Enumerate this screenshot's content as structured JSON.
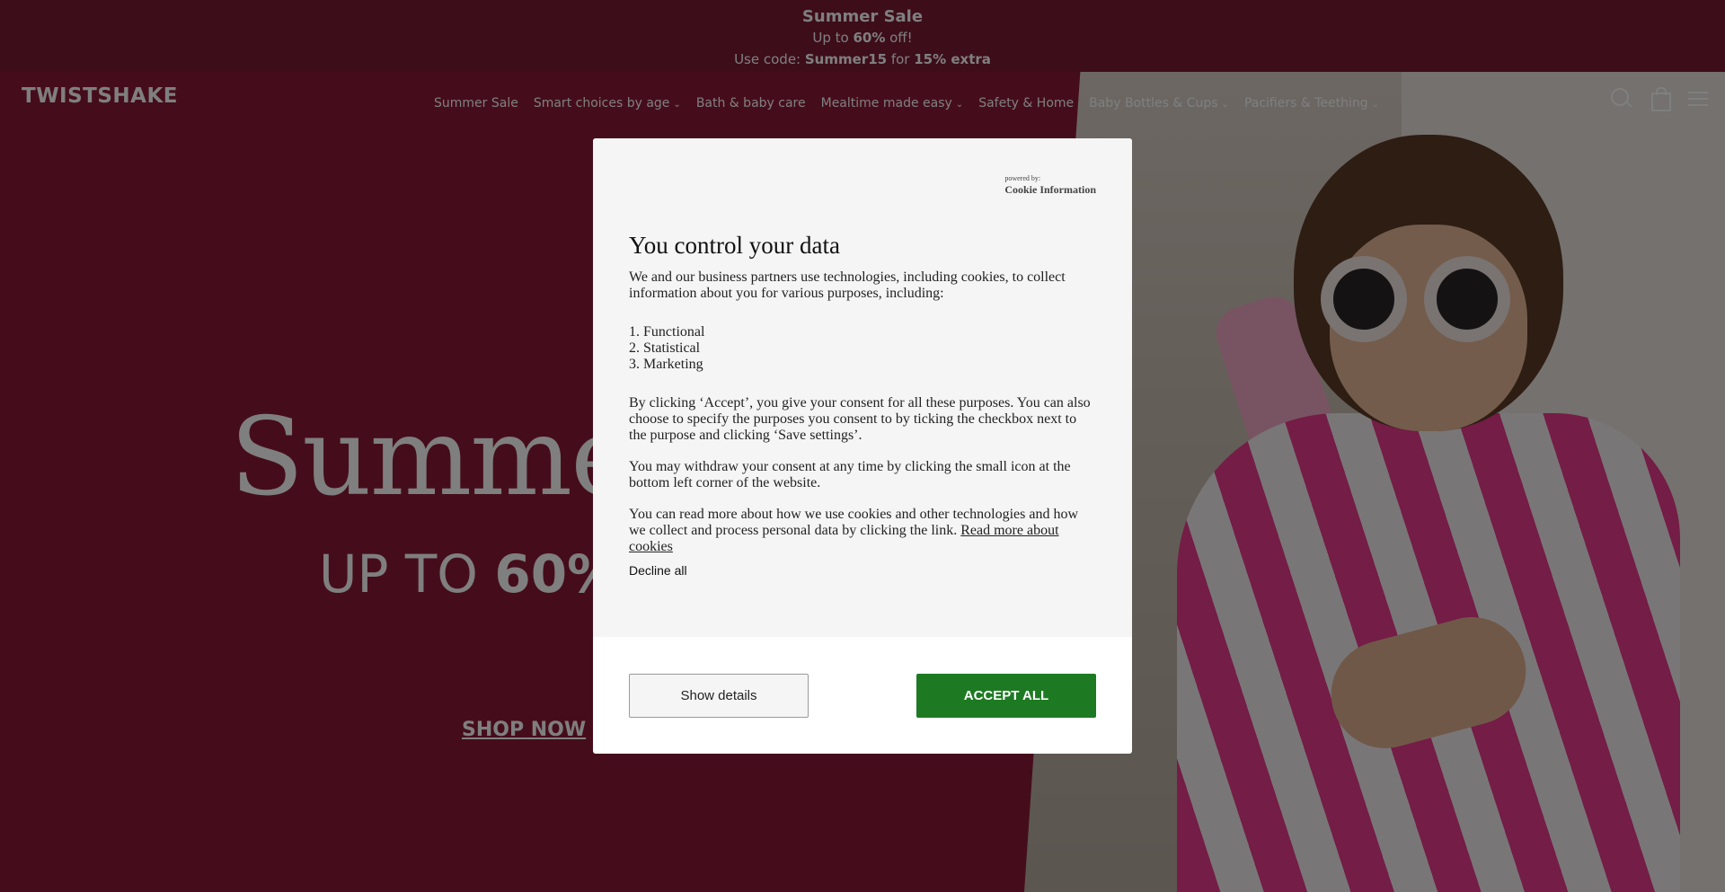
{
  "announcement": {
    "title": "Summer Sale",
    "line1_prefix": "Up to ",
    "line1_bold": "60%",
    "line1_suffix": " off!",
    "line2_prefix": "Use code: ",
    "line2_code": "Summer15",
    "line2_mid": " for ",
    "line2_bold": "15% extra"
  },
  "header": {
    "logo": "TWISTSHAKE",
    "nav": [
      {
        "label": "Summer Sale",
        "dropdown": false
      },
      {
        "label": "Smart choices by age",
        "dropdown": true
      },
      {
        "label": "Bath & baby care",
        "dropdown": false
      },
      {
        "label": "Mealtime made easy",
        "dropdown": true
      },
      {
        "label": "Safety & Home",
        "dropdown": false
      },
      {
        "label": "Baby Bottles & Cups",
        "dropdown": true
      },
      {
        "label": "Pacifiers & Teething",
        "dropdown": true
      }
    ],
    "icons": [
      "search-icon",
      "bag-icon",
      "menu-icon"
    ]
  },
  "hero": {
    "title": "Summer",
    "subtitle_prefix": "UP TO ",
    "subtitle_bold": "60%",
    "cta": "SHOP NOW"
  },
  "modal": {
    "powered_by": "powered by:",
    "brand": "Cookie Information",
    "heading": "You control your data",
    "intro": "We and our business partners use technologies, including cookies, to collect information about you for various purposes, including:",
    "purposes": [
      "1. Functional",
      "2. Statistical",
      "3. Marketing"
    ],
    "consent_text": "By clicking ‘Accept’, you give your consent for all these purposes. You can also choose to specify the purposes you consent to by ticking the checkbox next to the purpose and clicking ‘Save settings’.",
    "withdraw_text": "You may withdraw your consent at any time by clicking the small icon at the bottom left corner of the website.",
    "read_more_text": "You can read more about how we use cookies and other technologies and how we collect and process personal data by clicking the link. ",
    "read_more_link": "Read more about cookies",
    "decline_all": "Decline all",
    "show_details": "Show details",
    "accept_all": "ACCEPT ALL"
  },
  "colors": {
    "brand_burgundy": "#7a1a34",
    "accept_green": "#1d7a22",
    "overlay": "rgba(0,0,0,0.5)"
  }
}
